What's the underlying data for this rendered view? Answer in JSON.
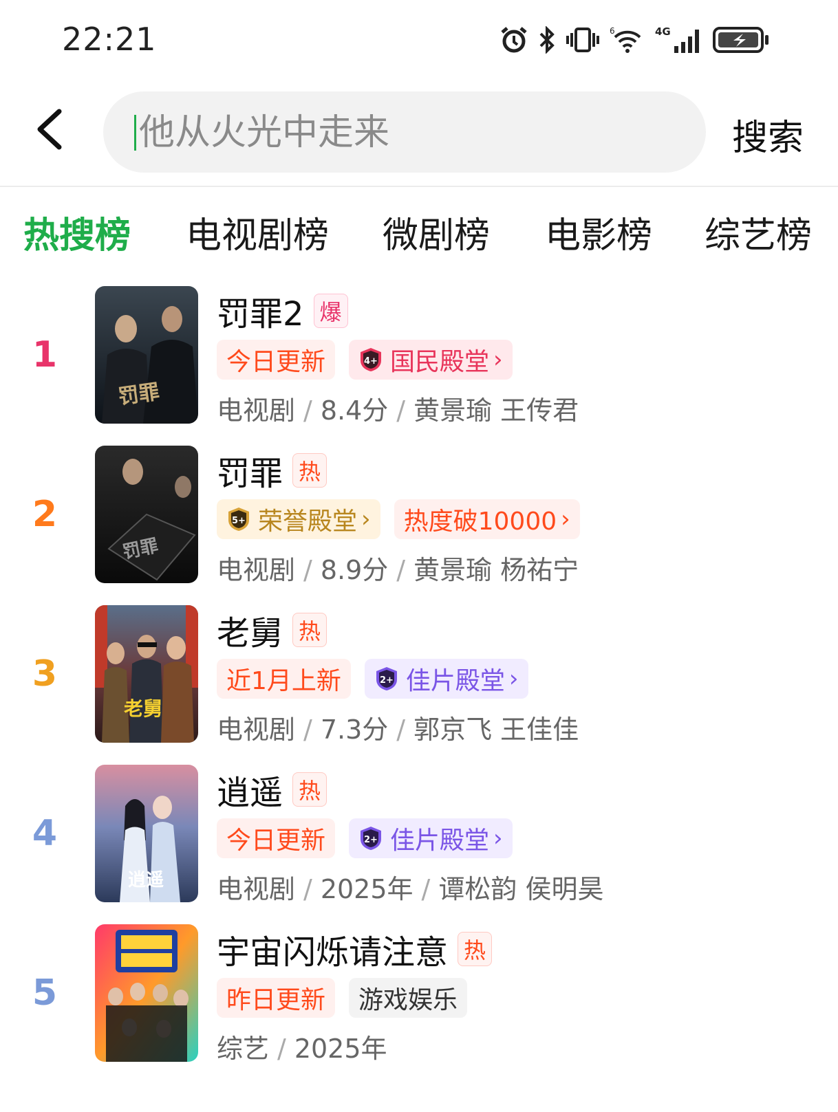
{
  "status_bar": {
    "time": "22:21"
  },
  "search": {
    "placeholder": "他从火光中走来",
    "value": "",
    "button_label": "搜索"
  },
  "tabs": [
    {
      "label": "热搜榜",
      "active": true
    },
    {
      "label": "电视剧榜",
      "active": false
    },
    {
      "label": "微剧榜",
      "active": false
    },
    {
      "label": "电影榜",
      "active": false
    },
    {
      "label": "综艺榜",
      "active": false
    }
  ],
  "items": [
    {
      "rank": "1",
      "rank_color": "#e8346a",
      "title": "罚罪2",
      "flag": "爆",
      "tags": [
        {
          "type": "update",
          "label": "今日更新"
        },
        {
          "type": "hall-red",
          "badge": "4+",
          "label": "国民殿堂"
        }
      ],
      "meta": {
        "category": "电视剧",
        "score": "8.4分",
        "cast": "黄景瑜 王传君"
      }
    },
    {
      "rank": "2",
      "rank_color": "#ff7a1c",
      "title": "罚罪",
      "flag": "热",
      "tags": [
        {
          "type": "hall-gold",
          "badge": "5+",
          "label": "荣誉殿堂"
        },
        {
          "type": "hot",
          "label": "热度破10000"
        }
      ],
      "meta": {
        "category": "电视剧",
        "score": "8.9分",
        "cast": "黄景瑜 杨祐宁"
      }
    },
    {
      "rank": "3",
      "rank_color": "#f0a020",
      "title": "老舅",
      "flag": "热",
      "tags": [
        {
          "type": "update",
          "label": "近1月上新"
        },
        {
          "type": "hall-purple",
          "badge": "2+",
          "label": "佳片殿堂"
        }
      ],
      "meta": {
        "category": "电视剧",
        "score": "7.3分",
        "cast": "郭京飞 王佳佳"
      }
    },
    {
      "rank": "4",
      "rank_color": "#7b9ad8",
      "title": "逍遥",
      "flag": "热",
      "tags": [
        {
          "type": "update",
          "label": "今日更新"
        },
        {
          "type": "hall-purple",
          "badge": "2+",
          "label": "佳片殿堂"
        }
      ],
      "meta": {
        "category": "电视剧",
        "score": "2025年",
        "cast": "谭松韵 侯明昊"
      }
    },
    {
      "rank": "5",
      "rank_color": "#7b9ad8",
      "title": "宇宙闪烁请注意",
      "flag": "热",
      "tags": [
        {
          "type": "update",
          "label": "昨日更新"
        },
        {
          "type": "gray",
          "label": "游戏娱乐"
        }
      ],
      "meta": {
        "category": "综艺",
        "score": "2025年",
        "cast": ""
      }
    }
  ],
  "icons": {
    "status": [
      "alarm-icon",
      "bluetooth-icon",
      "vibrate-icon",
      "wifi-icon",
      "signal-4g-icon",
      "battery-charging-icon"
    ],
    "back": "back-arrow-icon",
    "chevron": "chevron-right-icon"
  }
}
